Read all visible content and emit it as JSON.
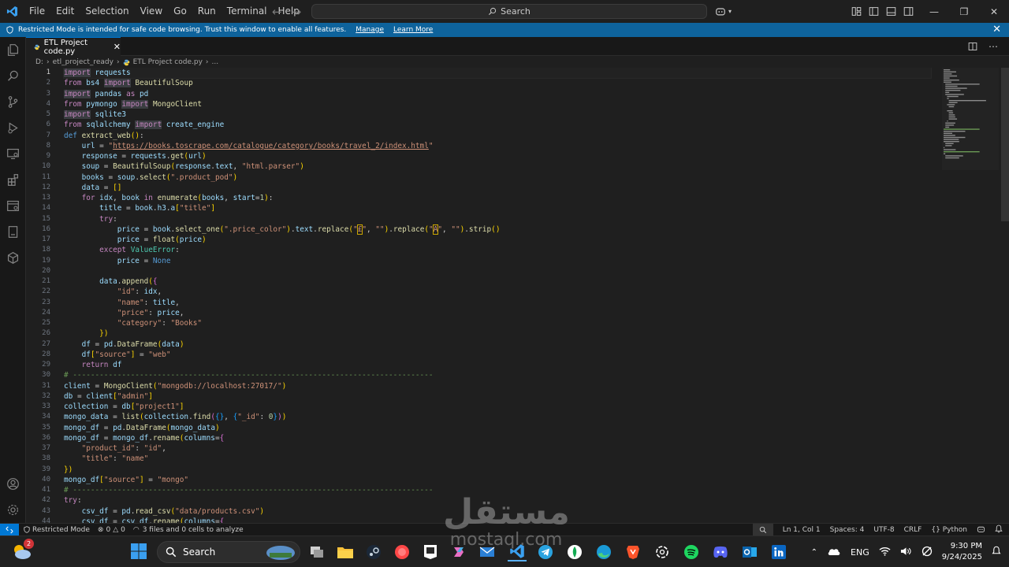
{
  "menubar": [
    "File",
    "Edit",
    "Selection",
    "View",
    "Go",
    "Run",
    "Terminal",
    "Help"
  ],
  "search": {
    "label": "Search"
  },
  "banner": {
    "text": "Restricted Mode is intended for safe code browsing. Trust this window to enable all features.",
    "manage": "Manage",
    "learn_more": "Learn More"
  },
  "tab": {
    "label": "ETL Project code.py"
  },
  "breadcrumb": {
    "drive": "D:",
    "folder": "etl_project_ready",
    "file": "ETL Project code.py",
    "more": "..."
  },
  "editor": {
    "current_line": 1,
    "line_numbers": [
      "1",
      "2",
      "3",
      "4",
      "5",
      "6",
      "7",
      "8",
      "9",
      "10",
      "11",
      "12",
      "13",
      "14",
      "15",
      "16",
      "17",
      "18",
      "19",
      "20",
      "21",
      "22",
      "23",
      "24",
      "25",
      "26",
      "27",
      "28",
      "29",
      "30",
      "31",
      "32",
      "33",
      "34",
      "35",
      "36",
      "37",
      "38",
      "39",
      "40",
      "41",
      "42",
      "43",
      "44"
    ],
    "code_lines": [
      "import requests",
      "from bs4 import BeautifulSoup",
      "import pandas as pd",
      "from pymongo import MongoClient",
      "import sqlite3",
      "from sqlalchemy import create_engine",
      "def extract_web():",
      "    url = \"https://books.toscrape.com/catalogue/category/books/travel_2/index.html\"",
      "    response = requests.get(url)",
      "    soup = BeautifulSoup(response.text, \"html.parser\")",
      "    books = soup.select(\".product_pod\")",
      "    data = []",
      "    for idx, book in enumerate(books, start=1):",
      "        title = book.h3.a[\"title\"]",
      "        try:",
      "            price = book.select_one(\".price_color\").text.replace(\"£\", \"\").replace(\"Â\", \"\").strip()",
      "            price = float(price)",
      "        except ValueError:",
      "            price = None",
      "",
      "        data.append({",
      "            \"id\": idx,",
      "            \"name\": title,",
      "            \"price\": price,",
      "            \"category\": \"Books\"",
      "        })",
      "    df = pd.DataFrame(data)",
      "    df[\"source\"] = \"web\"",
      "    return df",
      "# ---------------------------------------------------------------------------------",
      "client = MongoClient(\"mongodb://localhost:27017/\")",
      "db = client[\"admin\"]",
      "collection = db[\"project1\"]",
      "mongo_data = list(collection.find({}, {\"_id\": 0}))",
      "mongo_df = pd.DataFrame(mongo_data)",
      "mongo_df = mongo_df.rename(columns={",
      "    \"product_id\": \"id\",",
      "    \"title\": \"name\"",
      "})",
      "mongo_df[\"source\"] = \"mongo\"",
      "# ---------------------------------------------------------------------------------",
      "try:",
      "    csv_df = pd.read_csv(\"data/products.csv\")",
      "    csv_df = csv_df.rename(columns={"
    ]
  },
  "statusbar": {
    "restricted": "Restricted Mode",
    "errors": "0",
    "warnings": "0",
    "analysis": "3 files and 0 cells to analyze",
    "position": "Ln 1, Col 1",
    "spaces": "Spaces: 4",
    "encoding": "UTF-8",
    "eol": "CRLF",
    "language": "Python"
  },
  "taskbar": {
    "search_label": "Search",
    "weather_badge": "2",
    "language": "ENG",
    "time": "9:30 PM",
    "date": "9/24/2025"
  },
  "watermark": {
    "arabic": "مستقل",
    "latin": "mostaql.com"
  },
  "colors": {
    "accent": "#0078d4",
    "banner": "#0e639c",
    "keyword": "#c586c0",
    "string": "#ce9178",
    "function": "#dcdcaa",
    "comment": "#6a9955"
  }
}
